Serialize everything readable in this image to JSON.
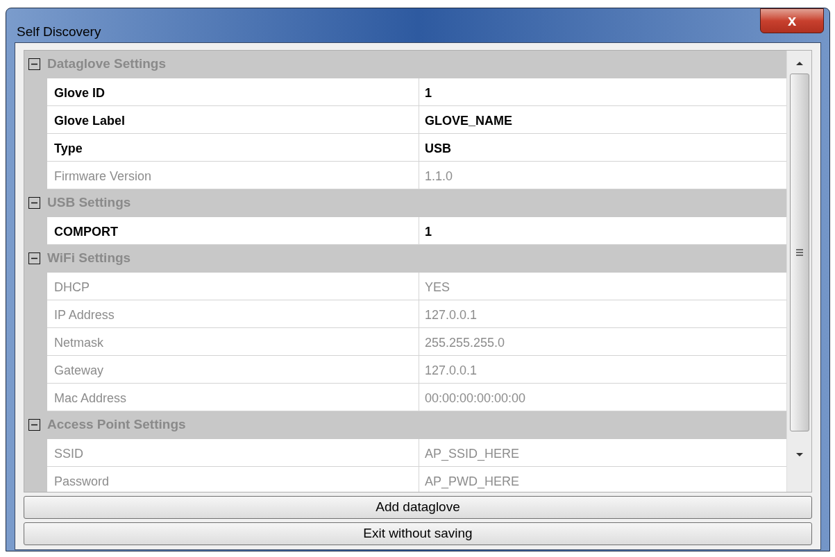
{
  "window": {
    "title": "Self Discovery",
    "close_label": "x"
  },
  "categories": [
    {
      "title": "Dataglove Settings",
      "expanded": true,
      "properties": [
        {
          "name": "Glove ID",
          "value": "1",
          "readonly": false
        },
        {
          "name": "Glove Label",
          "value": "GLOVE_NAME",
          "readonly": false
        },
        {
          "name": "Type",
          "value": "USB",
          "readonly": false
        },
        {
          "name": "Firmware Version",
          "value": "1.1.0",
          "readonly": true
        }
      ]
    },
    {
      "title": "USB Settings",
      "expanded": true,
      "properties": [
        {
          "name": "COMPORT",
          "value": "1",
          "readonly": false
        }
      ]
    },
    {
      "title": "WiFi Settings",
      "expanded": true,
      "properties": [
        {
          "name": "DHCP",
          "value": "YES",
          "readonly": true
        },
        {
          "name": "IP Address",
          "value": "127.0.0.1",
          "readonly": true
        },
        {
          "name": "Netmask",
          "value": "255.255.255.0",
          "readonly": true
        },
        {
          "name": "Gateway",
          "value": "127.0.0.1",
          "readonly": true
        },
        {
          "name": "Mac Address",
          "value": "00:00:00:00:00:00",
          "readonly": true
        }
      ]
    },
    {
      "title": "Access Point Settings",
      "expanded": true,
      "properties": [
        {
          "name": "SSID",
          "value": "AP_SSID_HERE",
          "readonly": true
        },
        {
          "name": "Password",
          "value": "AP_PWD_HERE",
          "readonly": true
        }
      ]
    }
  ],
  "buttons": [
    "Add dataglove",
    "Exit without saving"
  ]
}
